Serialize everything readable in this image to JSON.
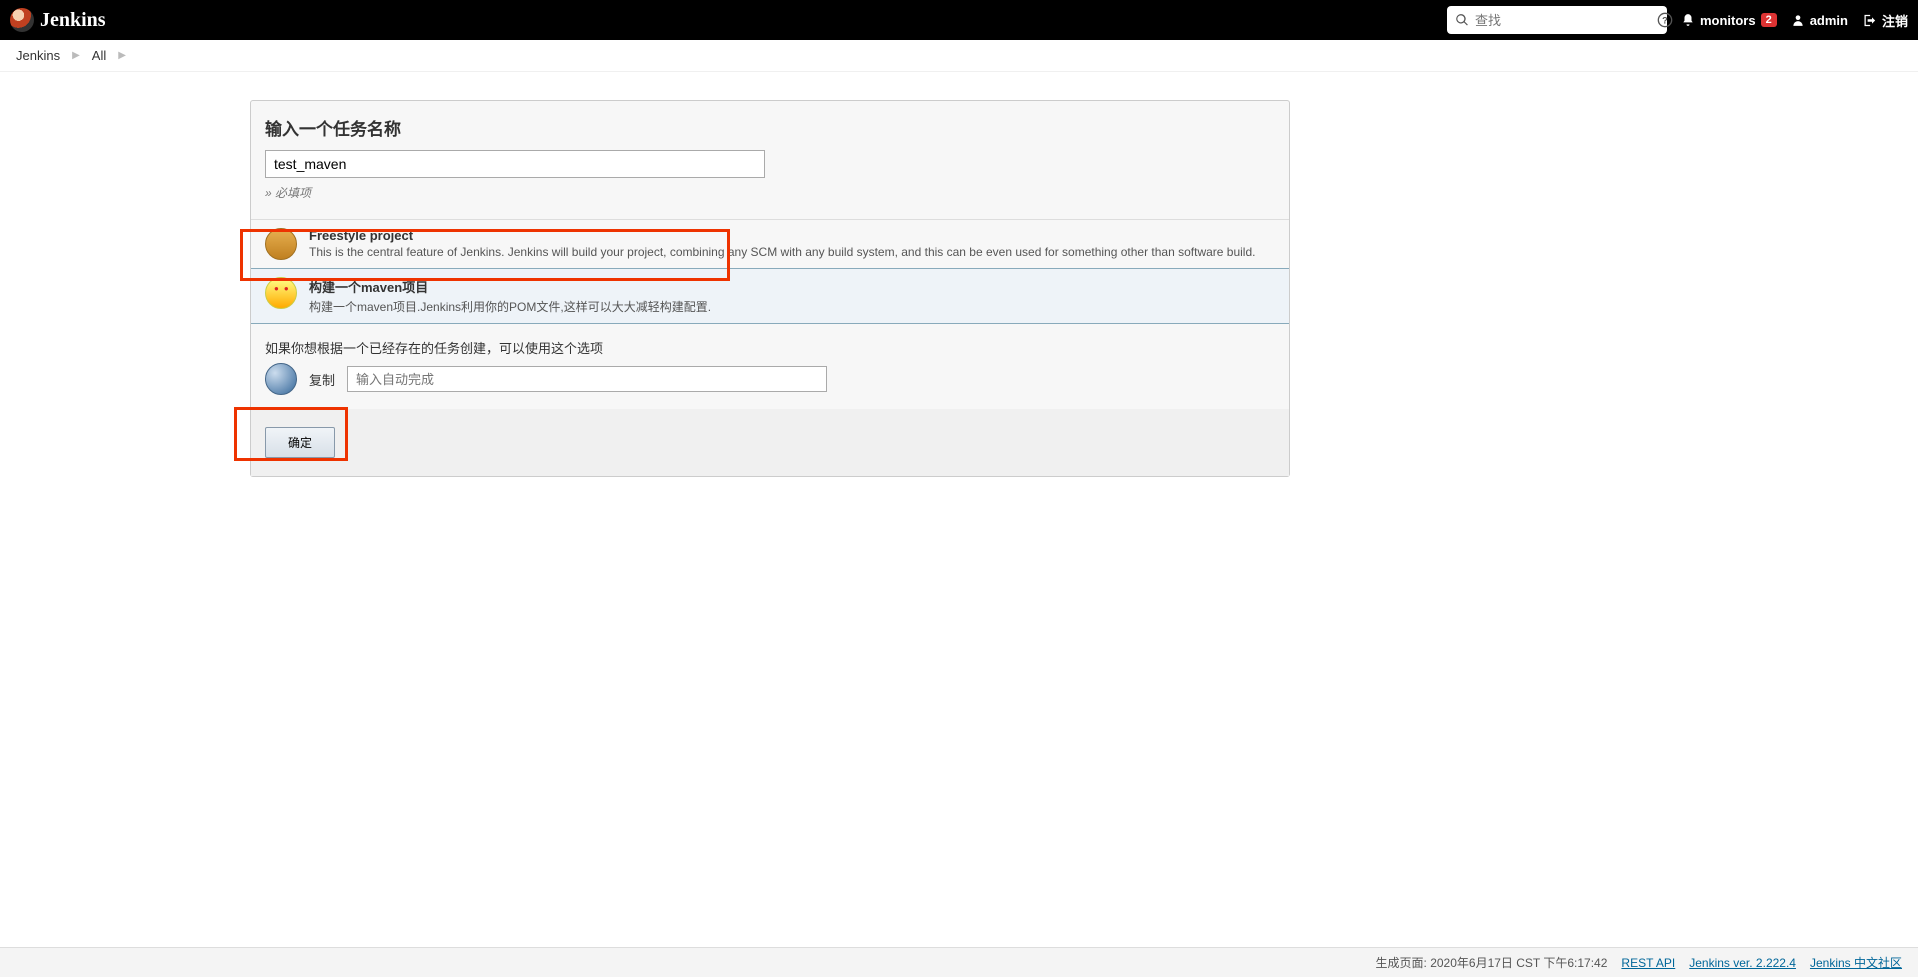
{
  "header": {
    "title": "Jenkins",
    "search_placeholder": "查找",
    "monitors_label": "monitors",
    "monitors_count": "2",
    "user_label": "admin",
    "logout_label": "注销"
  },
  "breadcrumbs": {
    "items": [
      "Jenkins",
      "All"
    ]
  },
  "form": {
    "name_section_title": "输入一个任务名称",
    "name_value": "test_maven",
    "required_note": "» 必填项",
    "types": [
      {
        "title": "Freestyle project",
        "desc": "This is the central feature of Jenkins. Jenkins will build your project, combining any SCM with any build system, and this can be even used for something other than software build."
      },
      {
        "title": "构建一个maven项目",
        "desc": "构建一个maven项目.Jenkins利用你的POM文件,这样可以大大减轻构建配置."
      }
    ],
    "copy_hint": "如果你想根据一个已经存在的任务创建，可以使用这个选项",
    "copy_label": "复制",
    "copy_placeholder": "输入自动完成",
    "ok_label": "确定"
  },
  "footer": {
    "generated_label": "生成页面:",
    "generated_time": "2020年6月17日 CST 下午6:17:42",
    "rest_api": "REST API",
    "version": "Jenkins ver. 2.222.4",
    "community": "Jenkins 中文社区"
  }
}
